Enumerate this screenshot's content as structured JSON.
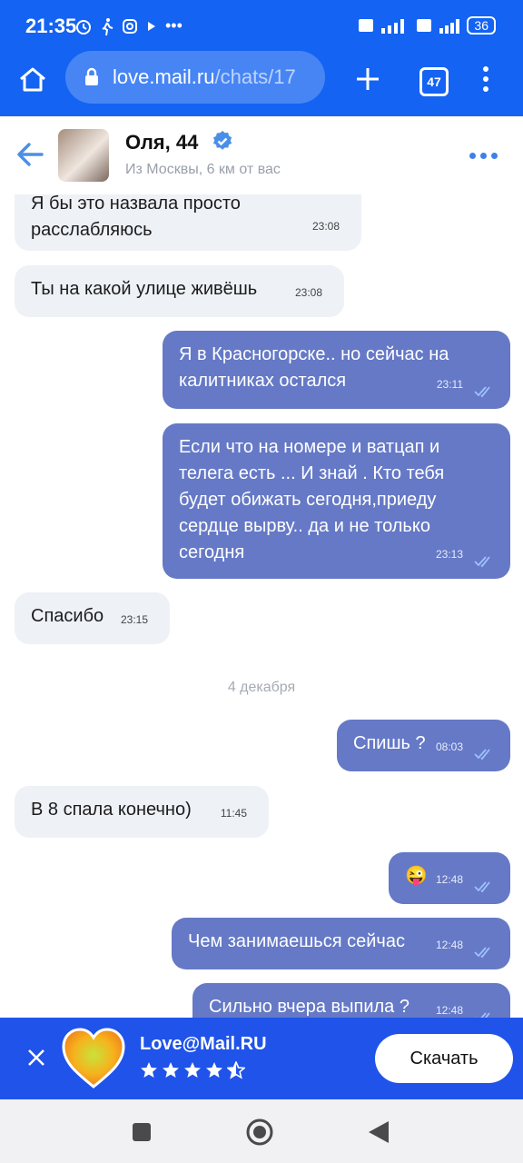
{
  "status_bar": {
    "time": "21:35",
    "battery": "36"
  },
  "browser": {
    "url_host": "love.mail.ru",
    "url_path": "/chats/17",
    "tabs_count": "47"
  },
  "chat_header": {
    "name": "Оля, 44",
    "location": "Из Москвы, 6 км от вас"
  },
  "messages": [
    {
      "dir": "in",
      "text": "Я бы это назвала просто расслабляюсь",
      "time": "23:08"
    },
    {
      "dir": "in",
      "text": "Ты на какой улице живёшь",
      "time": "23:08"
    },
    {
      "dir": "out",
      "text": "Я в Красногорске.. но сейчас на калитниках остался",
      "time": "23:11"
    },
    {
      "dir": "out",
      "text": "Если что на номере и ватцап и телега есть ... И знай . Кто тебя будет обижать сегодня,приеду сердце вырву.. да и не только сегодня",
      "time": "23:13"
    },
    {
      "dir": "in",
      "text": "Спасибо",
      "time": "23:15"
    },
    {
      "dir": "out",
      "text": "Спишь ?",
      "time": "08:03"
    },
    {
      "dir": "in",
      "text": "В 8 спала конечно)",
      "time": "11:45"
    },
    {
      "dir": "out",
      "text": "😜",
      "time": "12:48"
    },
    {
      "dir": "out",
      "text": "Чем занимаешься сейчас",
      "time": "12:48"
    },
    {
      "dir": "out",
      "text": "Сильно вчера выпила ?",
      "time": "12:48"
    }
  ],
  "date_separator": "4 декабря",
  "app_banner": {
    "app_name": "Love@Mail.RU",
    "rating": 4.5,
    "download_label": "Скачать"
  },
  "colors": {
    "primary_blue": "#1463f3",
    "outgoing_bubble": "#6579c6",
    "incoming_bubble": "#eef1f6",
    "banner_blue": "#1f53ea"
  },
  "icons": [
    "home-icon",
    "lock-icon",
    "plus-icon",
    "tabs-icon",
    "menu-dots-icon",
    "back-arrow-icon",
    "verified-icon",
    "more-dots-icon",
    "read-ticks-icon",
    "close-icon",
    "heart-logo",
    "star-icon",
    "recents-icon",
    "home-nav-icon",
    "back-nav-icon"
  ]
}
